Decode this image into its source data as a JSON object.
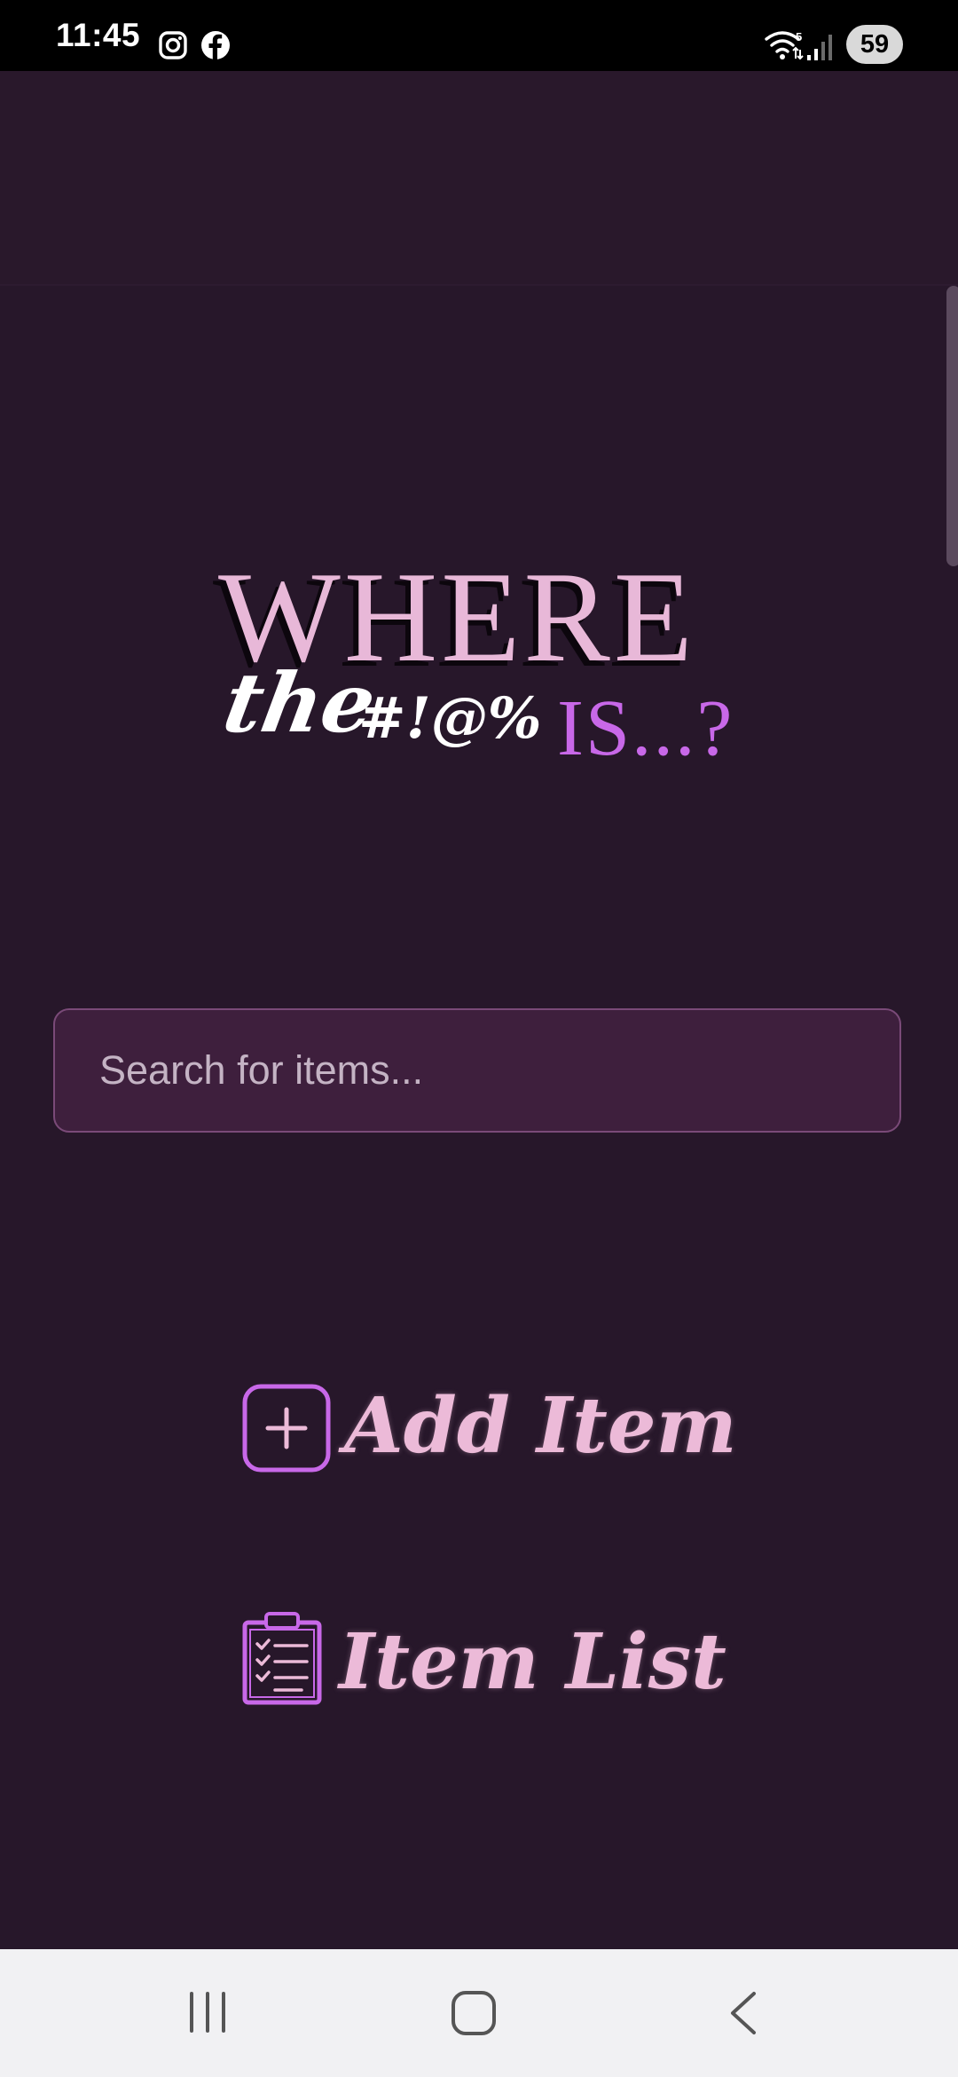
{
  "status_bar": {
    "time": "11:45",
    "app_icons": [
      "instagram-icon",
      "facebook-icon"
    ],
    "right_icons": [
      "wifi-icon",
      "signal-icon"
    ],
    "battery": "59"
  },
  "logo": {
    "line1": "WHERE",
    "line2_script": "the",
    "line2_symbols": "#!@%",
    "line2_end": "IS...?"
  },
  "search": {
    "placeholder": "Search for items...",
    "value": ""
  },
  "actions": {
    "add_item_label": "Add Item",
    "item_list_label": "Item List"
  },
  "nav": {
    "buttons": [
      "recent-apps",
      "home",
      "back"
    ]
  },
  "colors": {
    "background": "#27172a",
    "accent_pink": "#ecbad8",
    "accent_purple": "#c868e8",
    "search_bg": "#3e1f3d"
  }
}
